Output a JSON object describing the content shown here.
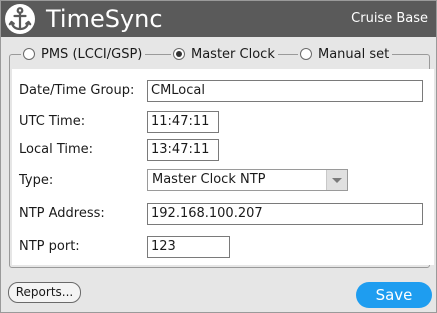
{
  "header": {
    "title": "TimeSync",
    "right_label": "Cruise Base",
    "background": "#5a5a5a"
  },
  "mode_options": [
    {
      "label": "PMS (LCCI/GSP)",
      "selected": false
    },
    {
      "label": "Master Clock",
      "selected": true
    },
    {
      "label": "Manual set",
      "selected": false
    }
  ],
  "form": {
    "dtg": {
      "label": "Date/Time Group:",
      "value": "CMLocal"
    },
    "utc": {
      "label": "UTC Time:",
      "value": "11:47:11"
    },
    "local": {
      "label": "Local Time:",
      "value": "13:47:11"
    },
    "type": {
      "label": "Type:",
      "value": "Master Clock NTP"
    },
    "ntp_address": {
      "label": "NTP Address:",
      "value": "192.168.100.207"
    },
    "ntp_port": {
      "label": "NTP port:",
      "value": "123"
    }
  },
  "buttons": {
    "reports_label": "Reports...",
    "save_label": "Save",
    "save_color": "#1e9df0"
  },
  "icons": {
    "logo": "anchor-icon",
    "select_arrow": "chevron-down-icon"
  }
}
